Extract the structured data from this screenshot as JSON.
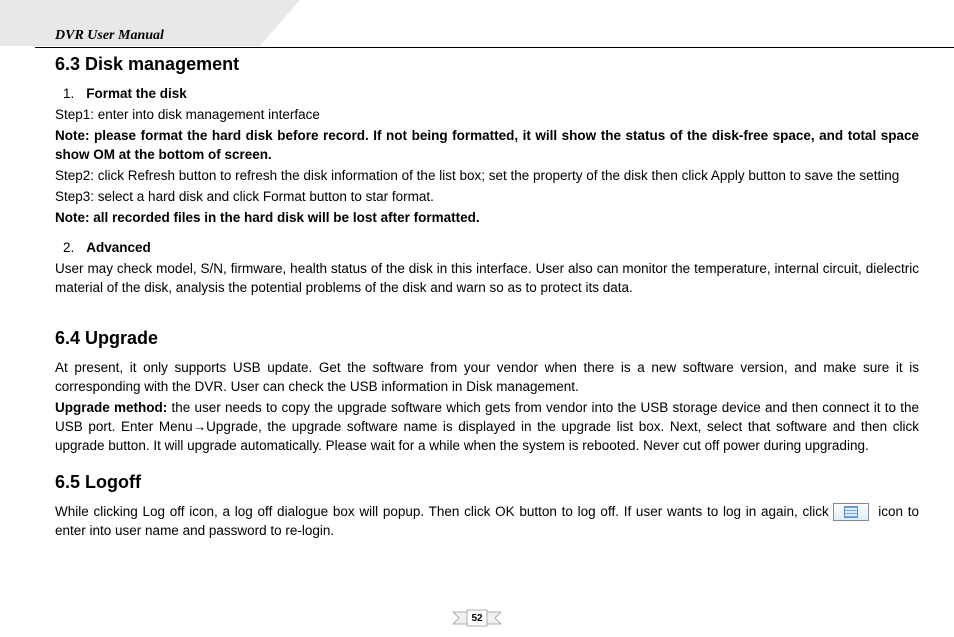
{
  "header": {
    "title": "DVR User Manual"
  },
  "section63": {
    "heading": "6.3  Disk management",
    "item1": {
      "num": "1.",
      "label": "Format the disk"
    },
    "step1": "Step1: enter into disk management interface",
    "note1": "Note: please format the hard disk before record. If not being formatted, it will show the status of the disk-free space, and total space show OM at the bottom of screen.",
    "step2": "Step2: click Refresh button to refresh the disk information of the list box; set the property of the disk then click Apply button to save the setting",
    "step3": "Step3: select a hard disk and click Format button to star format.",
    "note2": "Note: all recorded files in the hard disk will be lost after formatted.",
    "item2": {
      "num": "2.",
      "label": "Advanced"
    },
    "advanced_para": "User may check model, S/N, firmware, health status of the disk in this interface. User also can monitor the temperature, internal circuit, dielectric material of the disk, analysis the potential problems of the disk and warn so as to protect its data."
  },
  "section64": {
    "heading": "6.4  Upgrade",
    "para1": "At present, it only supports USB update. Get the software from your vendor when there is a new software version, and make sure it is corresponding with the DVR. User can check the USB information in Disk management.",
    "method_label": "Upgrade method: ",
    "method_text": "the user needs to copy the upgrade software which gets from vendor into the USB storage device and then connect it to the USB port. Enter Menu→Upgrade, the upgrade software name is displayed in the upgrade list box. Next, select that software and then click upgrade button. It will upgrade automatically. Please wait for a while when the system is rebooted. Never cut off power during upgrading."
  },
  "section65": {
    "heading": "6.5  Logoff",
    "para_pre": "While clicking Log off icon, a log off dialogue box will popup. Then click OK button to log off. If user wants to log in again, click ",
    "para_post": " icon to enter into user name and password to re-login."
  },
  "footer": {
    "page": "52"
  }
}
